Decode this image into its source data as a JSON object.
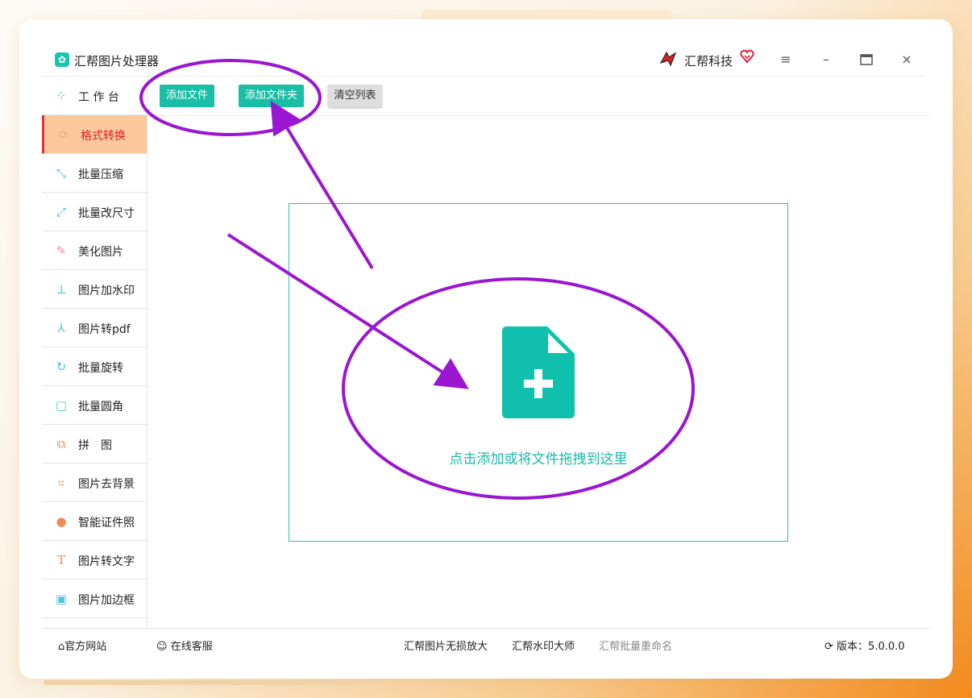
{
  "app": {
    "title": "汇帮图片处理器",
    "brand": "汇帮科技"
  },
  "window_controls": {
    "menu": "≡",
    "minimize": "–",
    "maximize": "▭",
    "close": "×"
  },
  "sidebar": {
    "items": [
      {
        "label": "工 作 台",
        "icon": "grid-icon"
      },
      {
        "label": "格式转换",
        "icon": "convert-icon",
        "active": true
      },
      {
        "label": "批量压缩",
        "icon": "compress-icon"
      },
      {
        "label": "批量改尺寸",
        "icon": "resize-icon"
      },
      {
        "label": "美化图片",
        "icon": "beautify-icon"
      },
      {
        "label": "图片加水印",
        "icon": "stamp-icon"
      },
      {
        "label": "图片转pdf",
        "icon": "pdf-icon"
      },
      {
        "label": "批量旋转",
        "icon": "rotate-icon"
      },
      {
        "label": "批量圆角",
        "icon": "round-corner-icon"
      },
      {
        "label": "拼　图",
        "icon": "puzzle-icon"
      },
      {
        "label": "图片去背景",
        "icon": "crop-icon"
      },
      {
        "label": "智能证件照",
        "icon": "person-icon"
      },
      {
        "label": "图片转文字",
        "icon": "text-icon"
      },
      {
        "label": "图片加边框",
        "icon": "frame-icon"
      }
    ]
  },
  "toolbar": {
    "add_file": "添加文件",
    "add_folder": "添加文件夹",
    "clear_list": "清空列表"
  },
  "dropzone": {
    "text": "点击添加或将文件拖拽到这里"
  },
  "footer": {
    "website": "官方网站",
    "support": "在线客服",
    "link1": "汇帮图片无损放大",
    "link2": "汇帮水印大师",
    "link3": "汇帮批量重命名",
    "version": "版本：5.0.0.0"
  },
  "colors": {
    "accent": "#18bfa6",
    "active_bg": "#fcc99c",
    "active_text": "#e02020",
    "annotation": "#9a16d0"
  }
}
